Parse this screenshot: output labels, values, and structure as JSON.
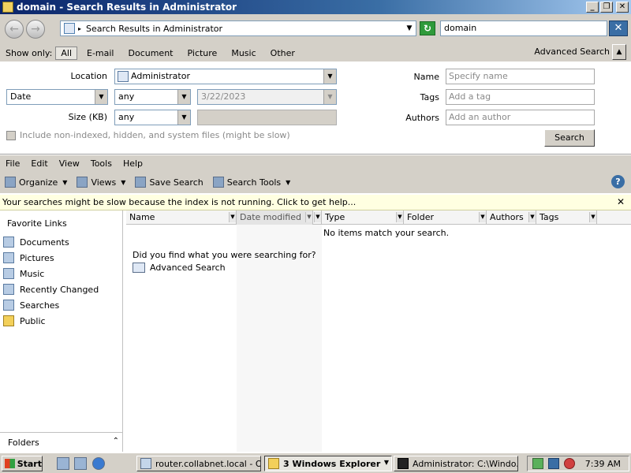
{
  "window": {
    "title": "domain - Search Results in Administrator",
    "min_label": "_",
    "max_label": "❐",
    "close_label": "✕"
  },
  "address_bar": {
    "back_glyph": "←",
    "forward_glyph": "→",
    "separator": "▸",
    "path": "Search Results in Administrator",
    "dropdown_glyph": "▼",
    "refresh_glyph": "↻",
    "search_value": "domain",
    "search_go_glyph": "✕"
  },
  "show_only": {
    "label": "Show only:",
    "items": [
      "All",
      "E-mail",
      "Document",
      "Picture",
      "Music",
      "Other"
    ],
    "selected": "All",
    "advanced_search_label": "Advanced Search",
    "toggle_glyph": "▲"
  },
  "advanced": {
    "location_label": "Location",
    "location_value": "Administrator",
    "date_field": "Date",
    "date_op": "any",
    "date_value": "3/22/2023",
    "size_label": "Size (KB)",
    "size_op": "any",
    "name_label": "Name",
    "name_placeholder": "Specify name",
    "tags_label": "Tags",
    "tags_placeholder": "Add a tag",
    "authors_label": "Authors",
    "authors_placeholder": "Add an author",
    "include_label": "Include non-indexed, hidden, and system files (might be slow)",
    "search_button": "Search",
    "arrow_glyph": "▼"
  },
  "menubar": [
    "File",
    "Edit",
    "View",
    "Tools",
    "Help"
  ],
  "commandbar": {
    "organize": "Organize",
    "views": "Views",
    "save_search": "Save Search",
    "search_tools": "Search Tools",
    "dd_glyph": "▼",
    "help_glyph": "?"
  },
  "infobar": {
    "message": "Your searches might be slow because the index is not running.  Click to get help...",
    "close_glyph": "✕"
  },
  "leftpane": {
    "title": "Favorite Links",
    "items": [
      "Documents",
      "Pictures",
      "Music",
      "Recently Changed",
      "Searches",
      "Public"
    ],
    "folders_label": "Folders",
    "folders_glyph": "⌃"
  },
  "content": {
    "columns": [
      "Name",
      "Date modified",
      "Type",
      "Folder",
      "Authors",
      "Tags"
    ],
    "dd_glyph": "▼",
    "empty_message": "No items match your search.",
    "did_you_find": "Did you find what you were searching for?",
    "advanced_search_link": "Advanced Search"
  },
  "taskbar": {
    "start": "Start",
    "buttons": [
      "router.collabnet.local - O...",
      "3 Windows Explorer",
      "Administrator: C:\\Windo..."
    ],
    "clock": "7:39 AM"
  }
}
